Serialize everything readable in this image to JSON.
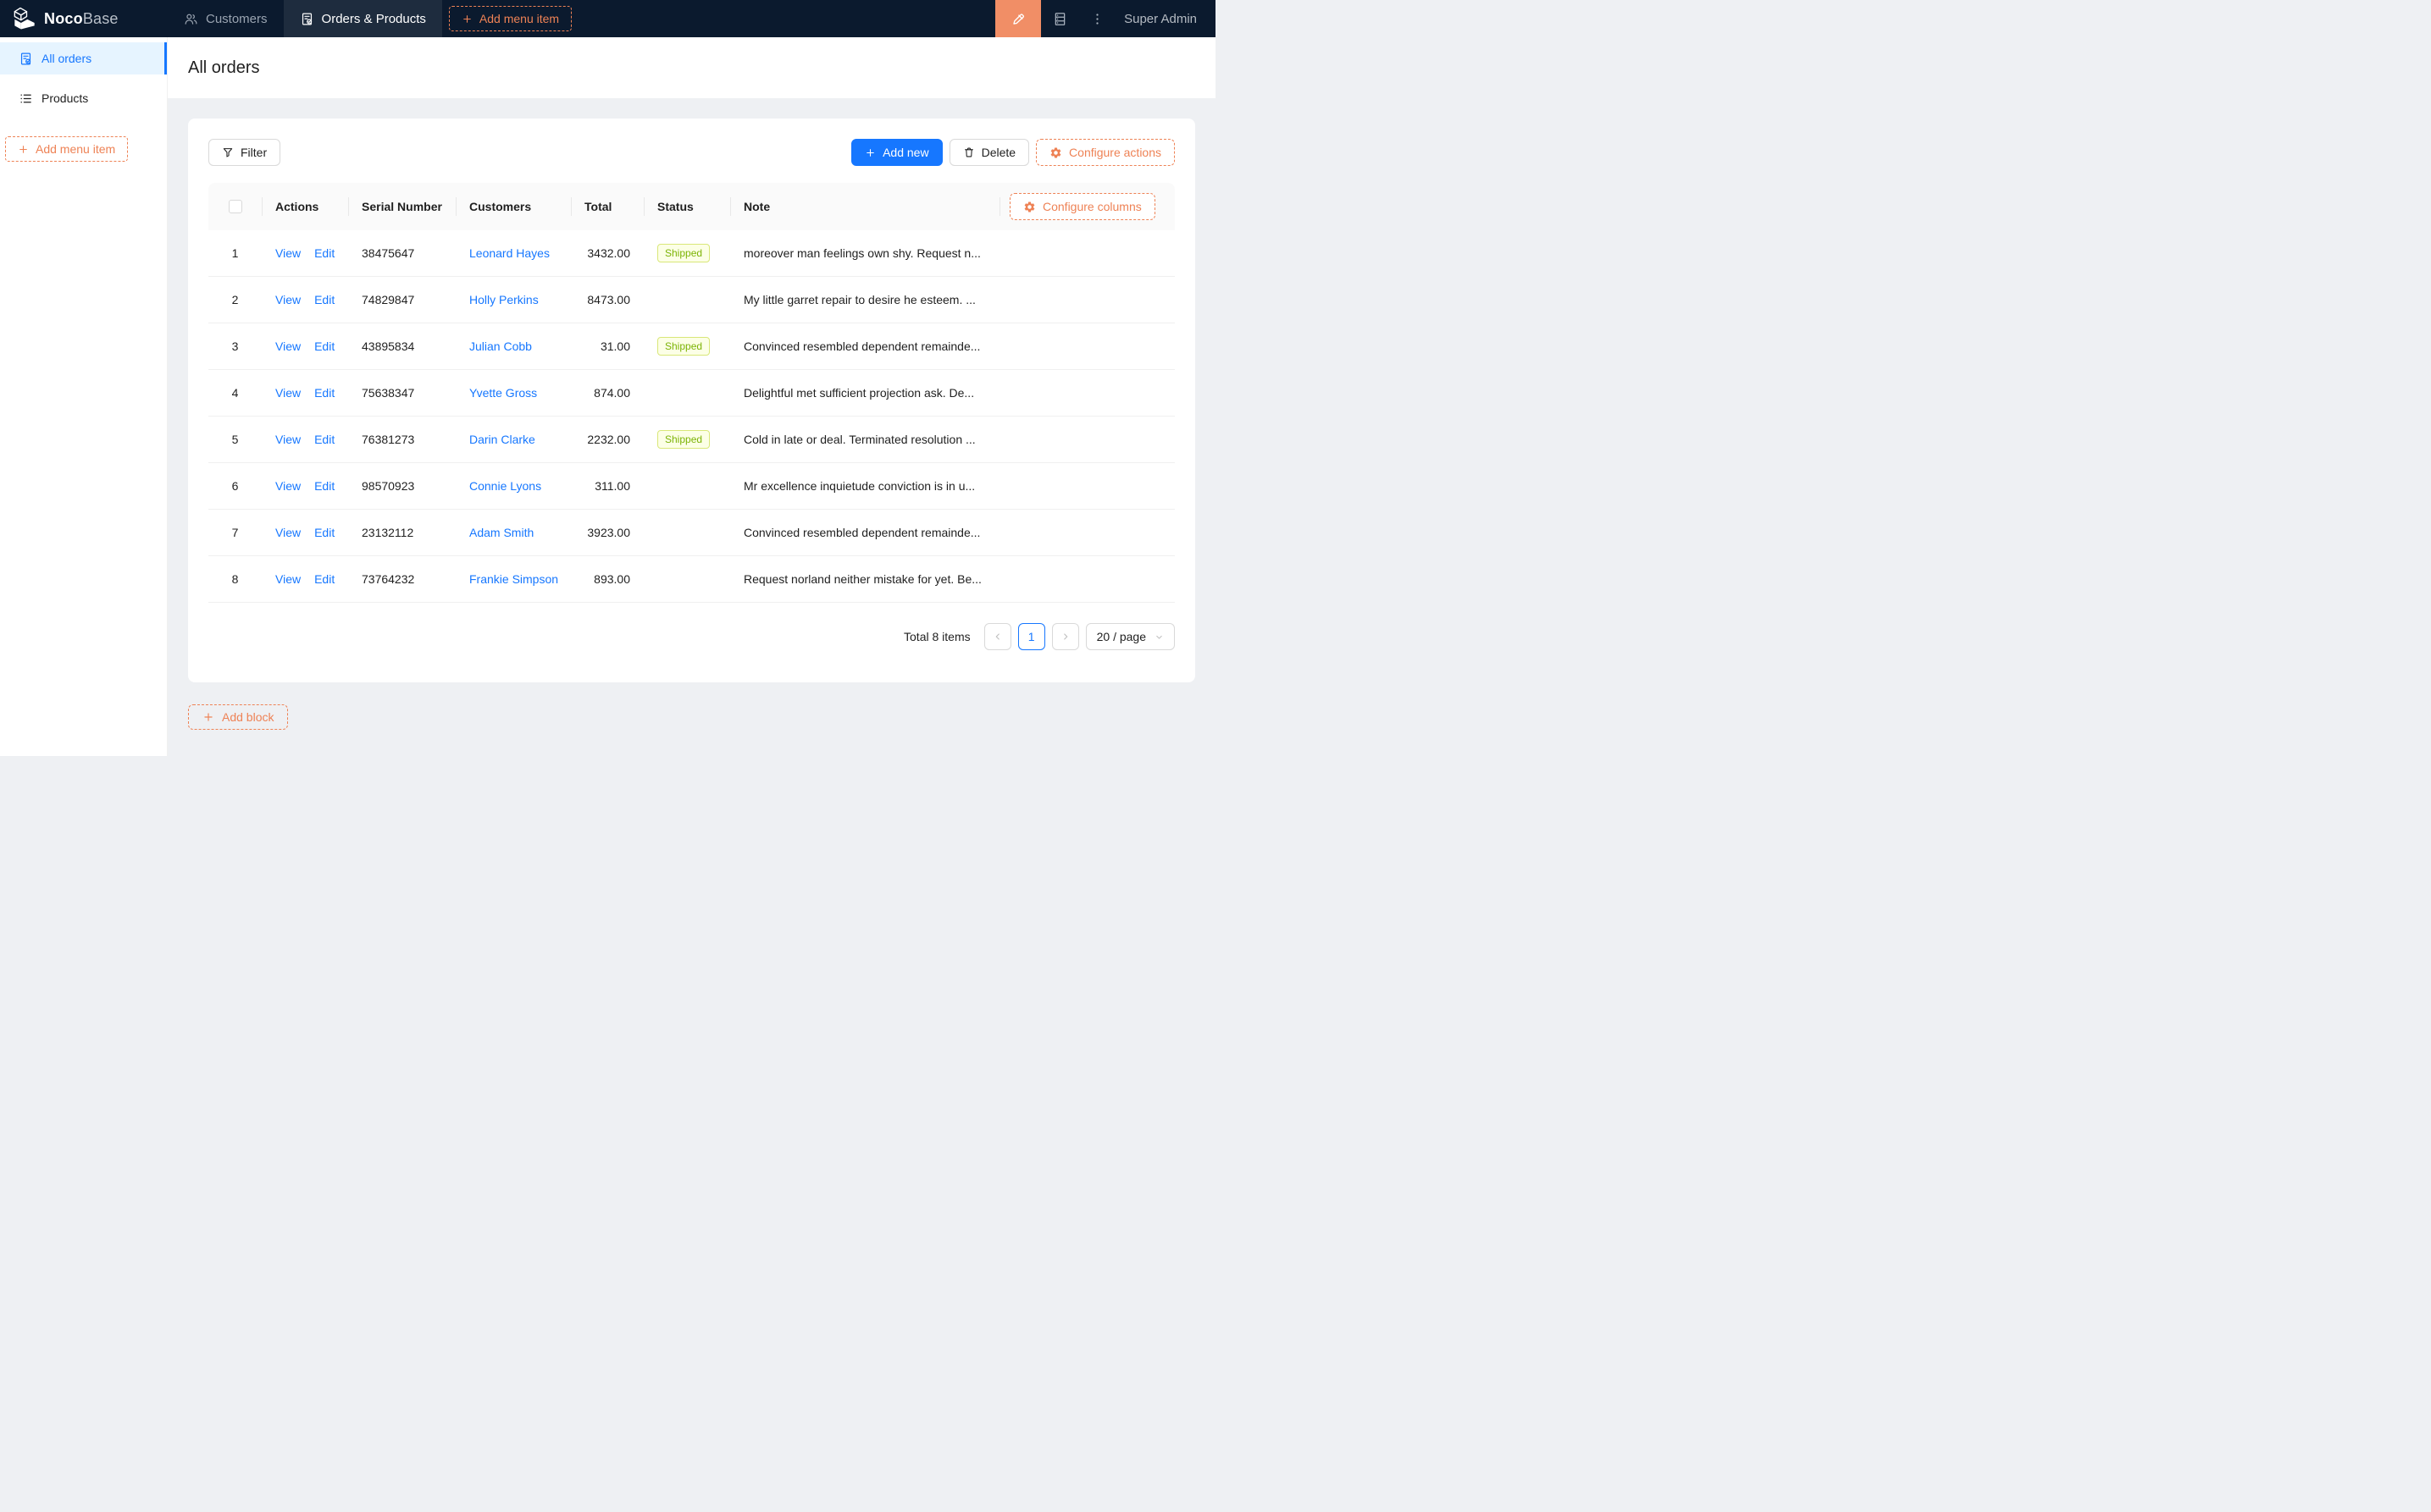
{
  "colors": {
    "orange_accent": "#ee8255",
    "orange_block": "#f18e66",
    "blue_accent": "#1677ff",
    "navbar_bg": "#0b1a2e",
    "navbar_selected_bg": "#1e2c3e",
    "lime_tag_bg": "#fcffe6",
    "lime_tag_border": "#d9e778",
    "lime_tag_text": "#7cb305"
  },
  "navbar": {
    "logo_bold": "Noco",
    "logo_light": "Base",
    "tabs": [
      {
        "label": "Customers",
        "icon": "customers-icon"
      },
      {
        "label": "Orders & Products",
        "icon": "orders-icon"
      }
    ],
    "add_menu_item_label": "Add menu item",
    "user": "Super Admin"
  },
  "sidebar": {
    "items": [
      {
        "label": "All orders",
        "icon": "order-check-icon",
        "selected": true
      },
      {
        "label": "Products",
        "icon": "list-icon",
        "selected": false
      }
    ],
    "add_menu_item_label": "Add menu item"
  },
  "page": {
    "title": "All orders"
  },
  "toolbar": {
    "filter_label": "Filter",
    "add_new_label": "Add new",
    "delete_label": "Delete",
    "configure_actions_label": "Configure actions"
  },
  "table": {
    "configure_columns_label": "Configure columns",
    "columns": [
      "Actions",
      "Serial Number",
      "Customers",
      "Total",
      "Status",
      "Note"
    ],
    "action_labels": {
      "view": "View",
      "edit": "Edit"
    },
    "rows": [
      {
        "index": "1",
        "serial": "38475647",
        "customer": "Leonard Hayes",
        "total": "3432.00",
        "status": "Shipped",
        "note": "moreover man feelings own shy. Request n..."
      },
      {
        "index": "2",
        "serial": "74829847",
        "customer": "Holly Perkins",
        "total": "8473.00",
        "status": "",
        "note": "My little garret repair to desire he esteem. ..."
      },
      {
        "index": "3",
        "serial": "43895834",
        "customer": "Julian Cobb",
        "total": "31.00",
        "status": "Shipped",
        "note": "Convinced resembled dependent remainde..."
      },
      {
        "index": "4",
        "serial": "75638347",
        "customer": "Yvette Gross",
        "total": "874.00",
        "status": "",
        "note": "Delightful met sufficient projection ask. De..."
      },
      {
        "index": "5",
        "serial": "76381273",
        "customer": "Darin Clarke",
        "total": "2232.00",
        "status": "Shipped",
        "note": "Cold in late or deal. Terminated resolution ..."
      },
      {
        "index": "6",
        "serial": "98570923",
        "customer": "Connie Lyons",
        "total": "311.00",
        "status": "",
        "note": "Mr excellence inquietude conviction is in u..."
      },
      {
        "index": "7",
        "serial": "23132112",
        "customer": "Adam Smith",
        "total": "3923.00",
        "status": "",
        "note": "Convinced resembled dependent remainde..."
      },
      {
        "index": "8",
        "serial": "73764232",
        "customer": "Frankie Simpson",
        "total": "893.00",
        "status": "",
        "note": "Request norland neither mistake for yet. Be..."
      }
    ]
  },
  "pagination": {
    "total_text": "Total 8 items",
    "current_page": "1",
    "page_size": "20 / page"
  },
  "footer": {
    "add_block_label": "Add block"
  }
}
